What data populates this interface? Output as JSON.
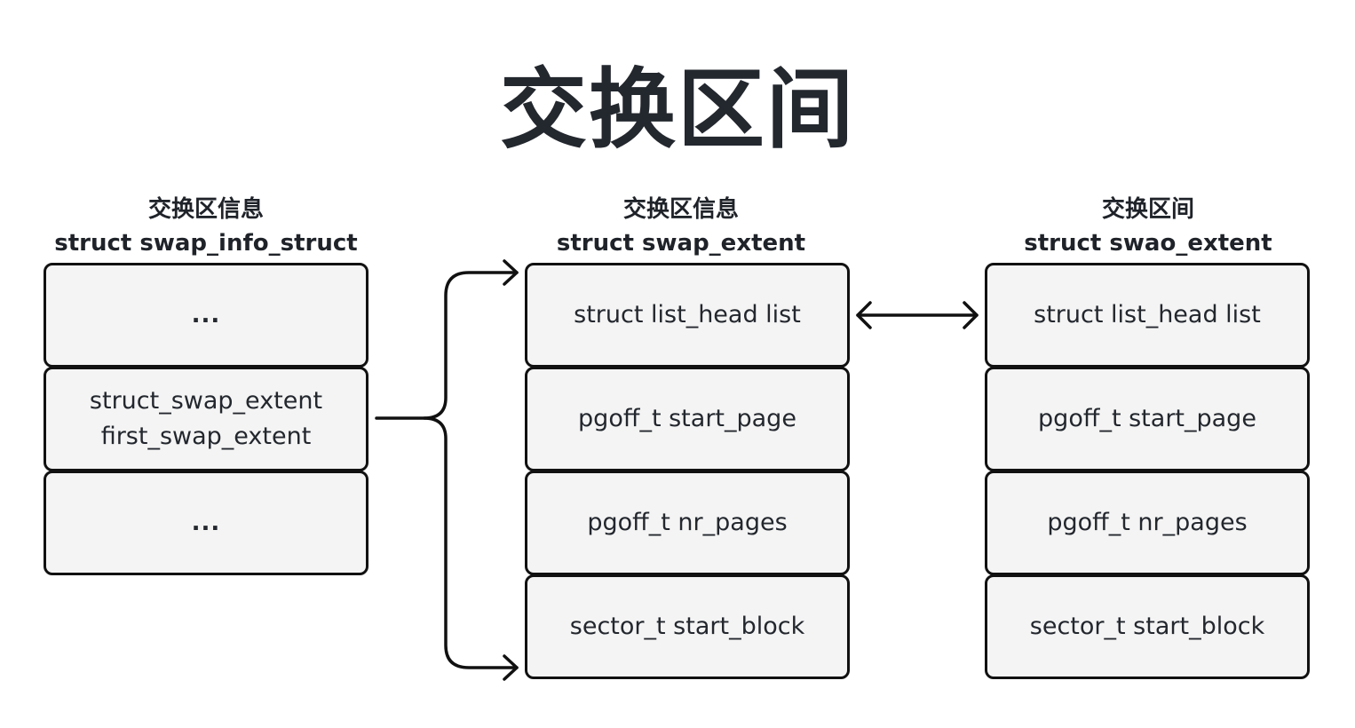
{
  "title": "交换区间",
  "columns": [
    {
      "header_cn": "交换区信息",
      "header_en": "struct swap_info_struct",
      "fields": [
        {
          "lines": [
            "..."
          ]
        },
        {
          "lines": [
            "struct_swap_extent",
            "first_swap_extent"
          ]
        },
        {
          "lines": [
            "..."
          ]
        }
      ]
    },
    {
      "header_cn": "交换区信息",
      "header_en": "struct swap_extent",
      "fields": [
        {
          "lines": [
            "struct list_head list"
          ]
        },
        {
          "lines": [
            "pgoff_t start_page"
          ]
        },
        {
          "lines": [
            "pgoff_t nr_pages"
          ]
        },
        {
          "lines": [
            "sector_t start_block"
          ]
        }
      ]
    },
    {
      "header_cn": "交换区间",
      "header_en": "struct swao_extent",
      "fields": [
        {
          "lines": [
            "struct list_head list"
          ]
        },
        {
          "lines": [
            "pgoff_t start_page"
          ]
        },
        {
          "lines": [
            "pgoff_t nr_pages"
          ]
        },
        {
          "lines": [
            "sector_t start_block"
          ]
        }
      ]
    }
  ],
  "connections": [
    {
      "from": "first_swap_extent",
      "to": "struct swap_extent",
      "type": "brace-arrow"
    },
    {
      "from": "struct list_head list",
      "to": "struct list_head list",
      "type": "bidirectional"
    }
  ],
  "colors": {
    "box_fill": "#f4f4f4",
    "box_stroke": "#111111",
    "text": "#23272e"
  }
}
